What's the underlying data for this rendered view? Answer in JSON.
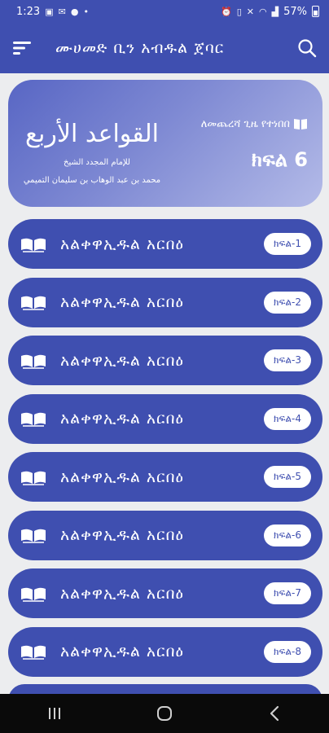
{
  "status_bar": {
    "time": "1:23",
    "battery": "57%"
  },
  "app_bar": {
    "title": "ሙሀመድ ቢን አብዱል ጀባር",
    "menu_icon": "menu-sort-icon",
    "search_icon": "search-icon"
  },
  "banner": {
    "subtitle": "ለመጨረሻ ጊዜ የተነበበ",
    "part_label": "ክፍል 6",
    "arabic_title": "القواعد الأربع",
    "arabic_line1": "للإمام المجدد الشيخ",
    "arabic_line2": "محمد بن عبد الوهاب بن سليمان التميمي"
  },
  "lessons": [
    {
      "title": "አልቀዋኢዱል አርበዕ",
      "badge": "ክፍል-1"
    },
    {
      "title": "አልቀዋኢዱል አርበዕ",
      "badge": "ክፍል-2"
    },
    {
      "title": "አልቀዋኢዱል አርበዕ",
      "badge": "ክፍል-3"
    },
    {
      "title": "አልቀዋኢዱል አርበዕ",
      "badge": "ክፍል-4"
    },
    {
      "title": "አልቀዋኢዱል አርበዕ",
      "badge": "ክፍል-5"
    },
    {
      "title": "አልቀዋኢዱል አርበዕ",
      "badge": "ክፍል-6"
    },
    {
      "title": "አልቀዋኢዱል አርበዕ",
      "badge": "ክፍል-7"
    },
    {
      "title": "አልቀዋኢዱል አርበዕ",
      "badge": "ክፍል-8"
    }
  ],
  "colors": {
    "primary": "#3f4fb0",
    "background": "#ecedef",
    "badge_bg": "#ffffff"
  },
  "nav": {
    "recents_icon": "recents-icon",
    "home_icon": "home-icon",
    "back_icon": "back-icon"
  }
}
